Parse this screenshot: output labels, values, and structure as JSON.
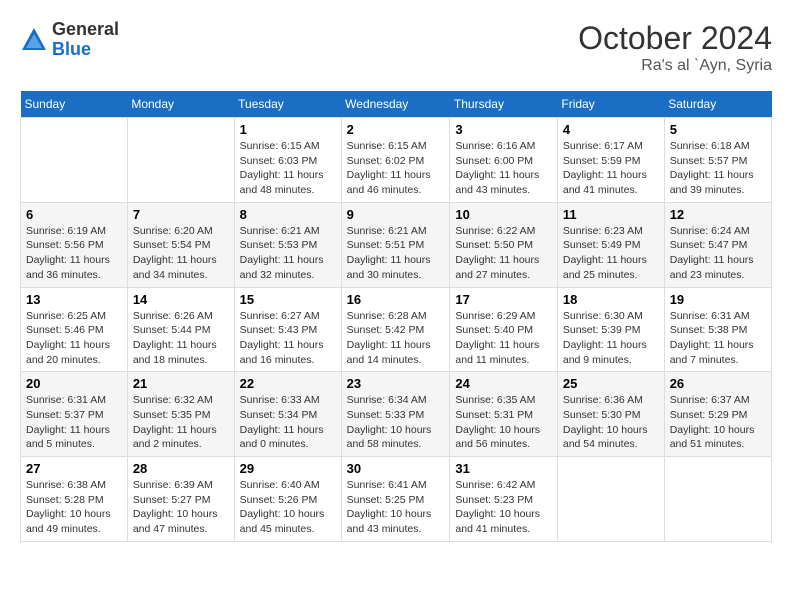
{
  "header": {
    "logo": {
      "general": "General",
      "blue": "Blue"
    },
    "title": "October 2024",
    "location": "Ra's al `Ayn, Syria"
  },
  "calendar": {
    "weekdays": [
      "Sunday",
      "Monday",
      "Tuesday",
      "Wednesday",
      "Thursday",
      "Friday",
      "Saturday"
    ],
    "weeks": [
      [
        {
          "day": "",
          "info": ""
        },
        {
          "day": "",
          "info": ""
        },
        {
          "day": "1",
          "info": "Sunrise: 6:15 AM\nSunset: 6:03 PM\nDaylight: 11 hours and 48 minutes."
        },
        {
          "day": "2",
          "info": "Sunrise: 6:15 AM\nSunset: 6:02 PM\nDaylight: 11 hours and 46 minutes."
        },
        {
          "day": "3",
          "info": "Sunrise: 6:16 AM\nSunset: 6:00 PM\nDaylight: 11 hours and 43 minutes."
        },
        {
          "day": "4",
          "info": "Sunrise: 6:17 AM\nSunset: 5:59 PM\nDaylight: 11 hours and 41 minutes."
        },
        {
          "day": "5",
          "info": "Sunrise: 6:18 AM\nSunset: 5:57 PM\nDaylight: 11 hours and 39 minutes."
        }
      ],
      [
        {
          "day": "6",
          "info": "Sunrise: 6:19 AM\nSunset: 5:56 PM\nDaylight: 11 hours and 36 minutes."
        },
        {
          "day": "7",
          "info": "Sunrise: 6:20 AM\nSunset: 5:54 PM\nDaylight: 11 hours and 34 minutes."
        },
        {
          "day": "8",
          "info": "Sunrise: 6:21 AM\nSunset: 5:53 PM\nDaylight: 11 hours and 32 minutes."
        },
        {
          "day": "9",
          "info": "Sunrise: 6:21 AM\nSunset: 5:51 PM\nDaylight: 11 hours and 30 minutes."
        },
        {
          "day": "10",
          "info": "Sunrise: 6:22 AM\nSunset: 5:50 PM\nDaylight: 11 hours and 27 minutes."
        },
        {
          "day": "11",
          "info": "Sunrise: 6:23 AM\nSunset: 5:49 PM\nDaylight: 11 hours and 25 minutes."
        },
        {
          "day": "12",
          "info": "Sunrise: 6:24 AM\nSunset: 5:47 PM\nDaylight: 11 hours and 23 minutes."
        }
      ],
      [
        {
          "day": "13",
          "info": "Sunrise: 6:25 AM\nSunset: 5:46 PM\nDaylight: 11 hours and 20 minutes."
        },
        {
          "day": "14",
          "info": "Sunrise: 6:26 AM\nSunset: 5:44 PM\nDaylight: 11 hours and 18 minutes."
        },
        {
          "day": "15",
          "info": "Sunrise: 6:27 AM\nSunset: 5:43 PM\nDaylight: 11 hours and 16 minutes."
        },
        {
          "day": "16",
          "info": "Sunrise: 6:28 AM\nSunset: 5:42 PM\nDaylight: 11 hours and 14 minutes."
        },
        {
          "day": "17",
          "info": "Sunrise: 6:29 AM\nSunset: 5:40 PM\nDaylight: 11 hours and 11 minutes."
        },
        {
          "day": "18",
          "info": "Sunrise: 6:30 AM\nSunset: 5:39 PM\nDaylight: 11 hours and 9 minutes."
        },
        {
          "day": "19",
          "info": "Sunrise: 6:31 AM\nSunset: 5:38 PM\nDaylight: 11 hours and 7 minutes."
        }
      ],
      [
        {
          "day": "20",
          "info": "Sunrise: 6:31 AM\nSunset: 5:37 PM\nDaylight: 11 hours and 5 minutes."
        },
        {
          "day": "21",
          "info": "Sunrise: 6:32 AM\nSunset: 5:35 PM\nDaylight: 11 hours and 2 minutes."
        },
        {
          "day": "22",
          "info": "Sunrise: 6:33 AM\nSunset: 5:34 PM\nDaylight: 11 hours and 0 minutes."
        },
        {
          "day": "23",
          "info": "Sunrise: 6:34 AM\nSunset: 5:33 PM\nDaylight: 10 hours and 58 minutes."
        },
        {
          "day": "24",
          "info": "Sunrise: 6:35 AM\nSunset: 5:31 PM\nDaylight: 10 hours and 56 minutes."
        },
        {
          "day": "25",
          "info": "Sunrise: 6:36 AM\nSunset: 5:30 PM\nDaylight: 10 hours and 54 minutes."
        },
        {
          "day": "26",
          "info": "Sunrise: 6:37 AM\nSunset: 5:29 PM\nDaylight: 10 hours and 51 minutes."
        }
      ],
      [
        {
          "day": "27",
          "info": "Sunrise: 6:38 AM\nSunset: 5:28 PM\nDaylight: 10 hours and 49 minutes."
        },
        {
          "day": "28",
          "info": "Sunrise: 6:39 AM\nSunset: 5:27 PM\nDaylight: 10 hours and 47 minutes."
        },
        {
          "day": "29",
          "info": "Sunrise: 6:40 AM\nSunset: 5:26 PM\nDaylight: 10 hours and 45 minutes."
        },
        {
          "day": "30",
          "info": "Sunrise: 6:41 AM\nSunset: 5:25 PM\nDaylight: 10 hours and 43 minutes."
        },
        {
          "day": "31",
          "info": "Sunrise: 6:42 AM\nSunset: 5:23 PM\nDaylight: 10 hours and 41 minutes."
        },
        {
          "day": "",
          "info": ""
        },
        {
          "day": "",
          "info": ""
        }
      ]
    ]
  }
}
